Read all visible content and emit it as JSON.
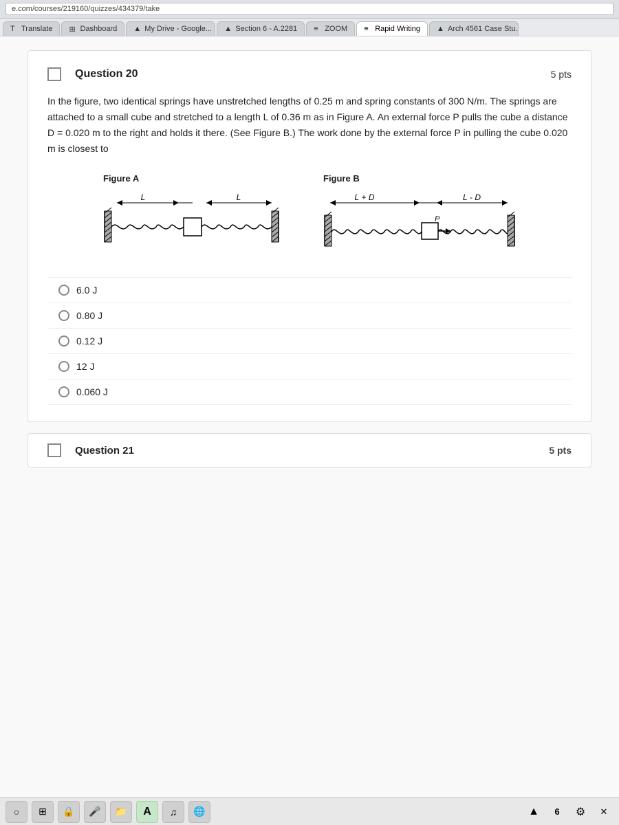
{
  "browser": {
    "url": "e.com/courses/219160/quizzes/434379/take"
  },
  "tabs": [
    {
      "id": "translate",
      "label": "Translate",
      "icon": "T",
      "active": false
    },
    {
      "id": "dashboard",
      "label": "Dashboard",
      "icon": "⊞",
      "active": false
    },
    {
      "id": "mydrive",
      "label": "My Drive - Google...",
      "icon": "▲",
      "active": false
    },
    {
      "id": "section6",
      "label": "Section 6 - A.2281",
      "icon": "▲",
      "active": false
    },
    {
      "id": "zoom",
      "label": "ZOOM",
      "icon": "≡",
      "active": false
    },
    {
      "id": "rapidwriting",
      "label": "Rapid Writing",
      "icon": "≡",
      "active": true
    },
    {
      "id": "arch",
      "label": "Arch 4561 Case Stu...",
      "icon": "▲",
      "active": false
    }
  ],
  "question": {
    "number": "Question 20",
    "points": "5 pts",
    "text": "In the figure, two identical springs have unstretched lengths of 0.25 m and spring constants of 300 N/m. The springs are attached to a small cube and stretched to a length L of 0.36 m as in Figure A. An external force P pulls the cube a distance D = 0.020 m to the right and holds it there. (See Figure B.) The work done by the external force P in pulling the cube 0.020 m is closest to",
    "figure_a_label": "Figure A",
    "figure_b_label": "Figure B",
    "answers": [
      {
        "id": "ans1",
        "label": "6.0 J"
      },
      {
        "id": "ans2",
        "label": "0.80 J"
      },
      {
        "id": "ans3",
        "label": "0.12 J"
      },
      {
        "id": "ans4",
        "label": "12 J"
      },
      {
        "id": "ans5",
        "label": "0.060 J"
      }
    ]
  },
  "question21": {
    "label": "Question 21",
    "points": "5 pts"
  },
  "taskbar": {
    "search_icon": "○",
    "grid_icon": "⊞",
    "lock_icon": "🔒",
    "mic_icon": "🎤",
    "folder_icon": "📁",
    "text_icon": "A",
    "music_icon": "♫",
    "browser_icon": "⬤",
    "wifi_icon": "▲",
    "badge": "6",
    "gear_icon": "⚙",
    "close_icon": "✕"
  }
}
